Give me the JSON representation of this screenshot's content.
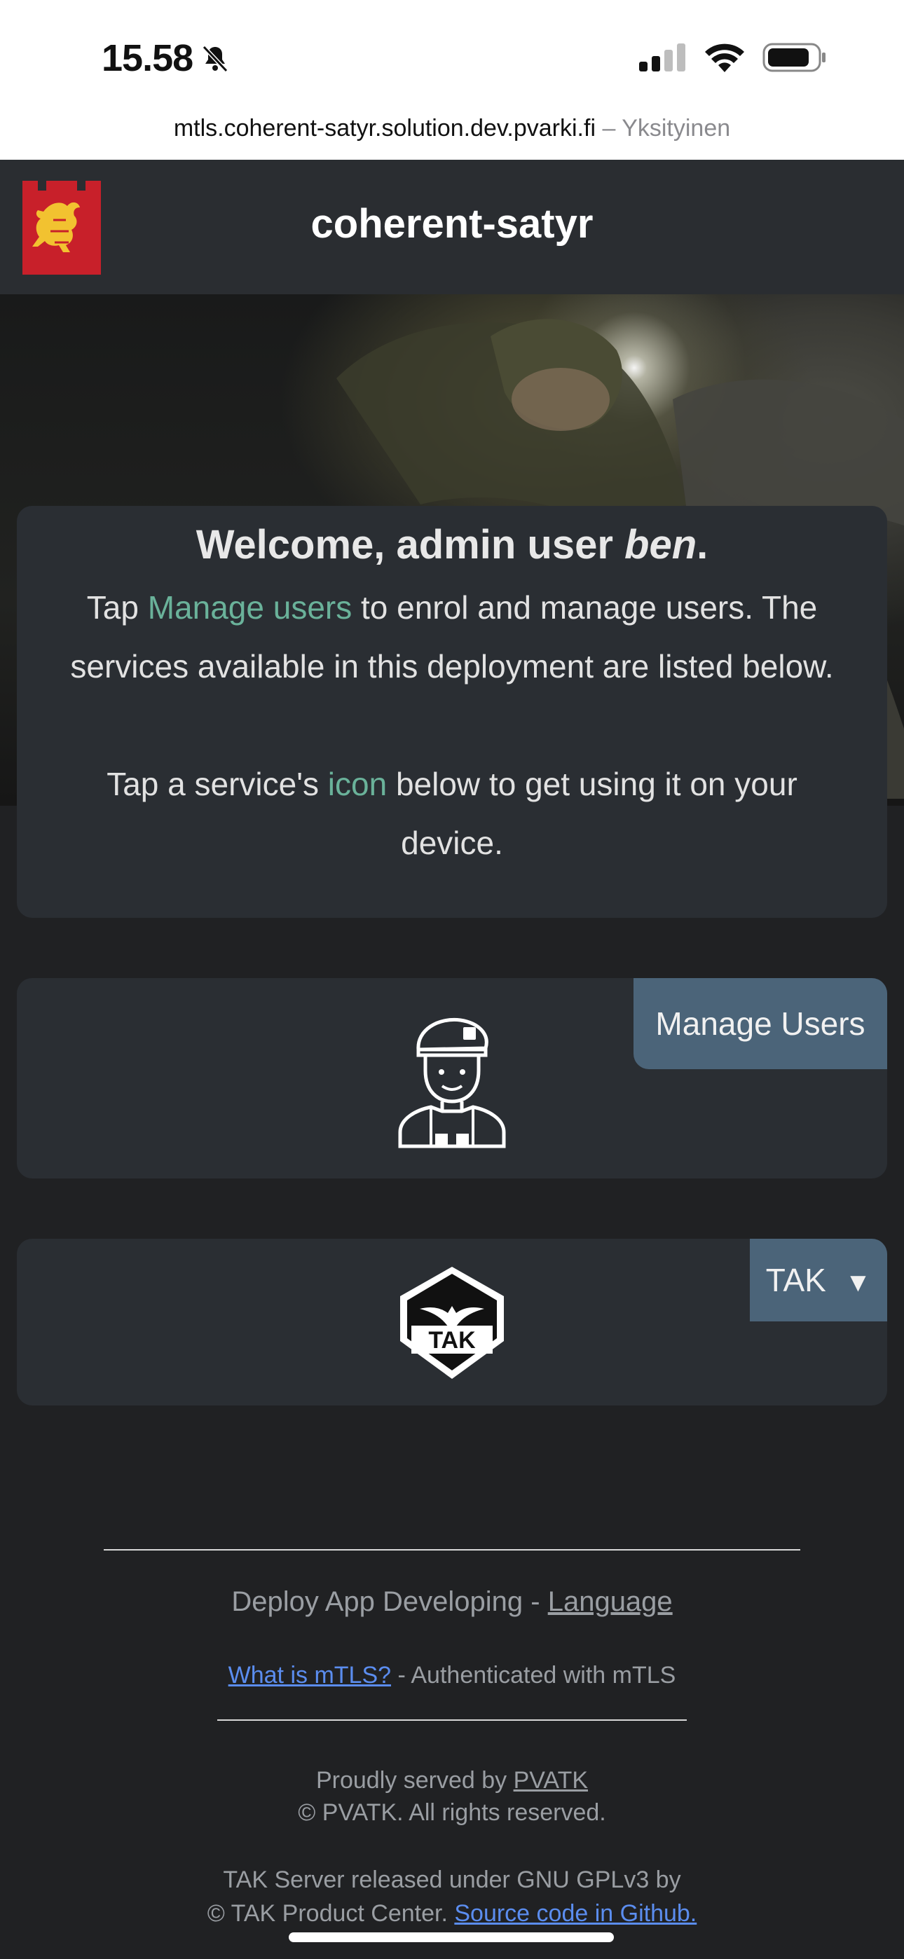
{
  "status_bar": {
    "time": "15.58"
  },
  "browser": {
    "url": "mtls.coherent-satyr.solution.dev.pvarki.fi",
    "separator": " – ",
    "mode": "Yksityinen"
  },
  "header": {
    "title": "coherent-satyr",
    "logo": "lion-coat-of-arms-icon"
  },
  "welcome": {
    "heading_prefix": "Welcome, admin user ",
    "username": "ben",
    "heading_suffix": ".",
    "line1_prefix": "Tap ",
    "manage_link": "Manage users",
    "line1_suffix": " to enrol and manage users. The services available in this deployment are listed below.",
    "line2_prefix": "Tap a service's ",
    "icon_word": "icon",
    "line2_suffix": " below to get using it on your device."
  },
  "services": [
    {
      "label": "Manage Users",
      "icon": "soldier-avatar-icon"
    },
    {
      "label": "TAK",
      "dropdown": "▼",
      "icon": "tak-badge-icon",
      "icon_text": "TAK"
    }
  ],
  "footer": {
    "app_text": "Deploy App Developing - ",
    "language_link": "Language",
    "mtls_link": "What is mTLS?",
    "mtls_text": " - Authenticated with mTLS",
    "served_text": "Proudly served by ",
    "pvatk_link": "PVATK",
    "rights": "© PVATK. All rights reserved.",
    "tak_license": "TAK Server released under GNU GPLv3 by",
    "tak_center": "© TAK Product Center. ",
    "source_link": "Source code in Github."
  },
  "colors": {
    "accent": "#6ab29a",
    "button": "#4b6479",
    "card": "#2a2e33",
    "background": "#202123",
    "link_blue": "#5b8def"
  }
}
